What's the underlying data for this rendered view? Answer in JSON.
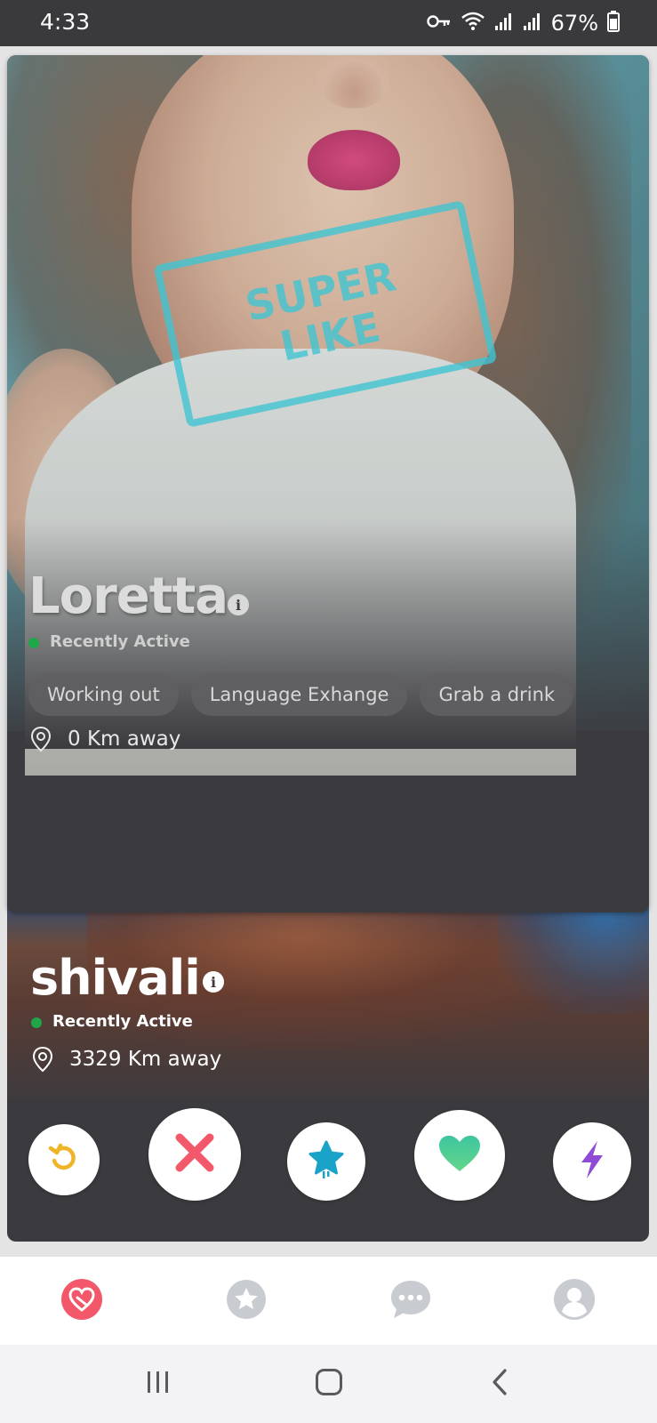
{
  "status_bar": {
    "time": "4:33",
    "battery": "67%",
    "icons": [
      "vpn-key-icon",
      "wifi-icon",
      "signal-icon",
      "signal-icon",
      "battery-icon"
    ]
  },
  "front_card": {
    "name": "Loretta",
    "active_status": "Recently Active",
    "interests": [
      "Working out",
      "Language Exhange",
      "Grab a drink"
    ],
    "distance": "0 Km away",
    "stamp_line1": "SUPER",
    "stamp_line2": "LIKE"
  },
  "back_card": {
    "name": "shivali",
    "active_status": "Recently Active",
    "distance": "3329 Km away"
  },
  "actions": [
    {
      "name": "rewind-button",
      "icon": "rewind-icon",
      "color": "#f0b429"
    },
    {
      "name": "nope-button",
      "icon": "close-icon",
      "color": "#f2576a"
    },
    {
      "name": "super-like-button",
      "icon": "star-icon",
      "color": "#1aa3c8"
    },
    {
      "name": "like-button",
      "icon": "heart-icon",
      "color": "#3ec6a0"
    },
    {
      "name": "boost-button",
      "icon": "lightning-icon",
      "color": "#8f4bd6"
    }
  ],
  "bottom_nav": [
    {
      "name": "nav-discover",
      "icon": "app-logo-icon",
      "active": true,
      "color": "#f2576a"
    },
    {
      "name": "nav-likes",
      "icon": "star-badge-icon",
      "active": false,
      "color": "#c8cbd0"
    },
    {
      "name": "nav-messages",
      "icon": "chat-icon",
      "active": false,
      "color": "#c8cbd0"
    },
    {
      "name": "nav-profile",
      "icon": "profile-icon",
      "active": false,
      "color": "#c8cbd0"
    }
  ],
  "colors": {
    "card_background": "#3b3a3e",
    "active_dot": "#1fa74a",
    "stamp": "#40c4d2"
  }
}
